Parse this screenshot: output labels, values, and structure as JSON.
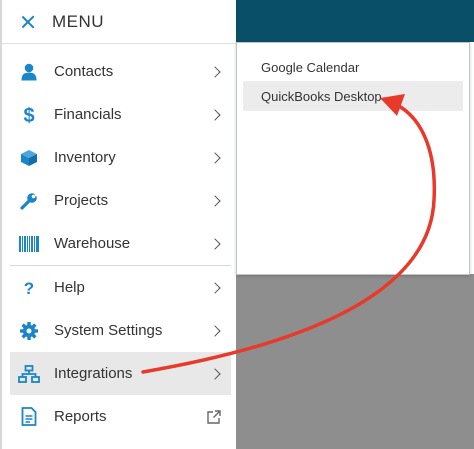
{
  "menu": {
    "title": "MENU",
    "items": [
      {
        "label": "Contacts",
        "icon": "person-icon"
      },
      {
        "label": "Financials",
        "icon": "dollar-icon"
      },
      {
        "label": "Inventory",
        "icon": "box-icon"
      },
      {
        "label": "Projects",
        "icon": "wrench-icon"
      },
      {
        "label": "Warehouse",
        "icon": "barcode-icon"
      },
      {
        "label": "Help",
        "icon": "question-icon"
      },
      {
        "label": "System Settings",
        "icon": "gear-icon"
      },
      {
        "label": "Integrations",
        "icon": "sitemap-icon"
      },
      {
        "label": "Reports",
        "icon": "document-icon"
      }
    ]
  },
  "submenu": {
    "items": [
      {
        "label": "Google Calendar"
      },
      {
        "label": "QuickBooks Desktop"
      }
    ]
  },
  "colors": {
    "accent": "#1a85c7",
    "header_bg": "#0a4f68",
    "arrow": "#e8392a"
  }
}
